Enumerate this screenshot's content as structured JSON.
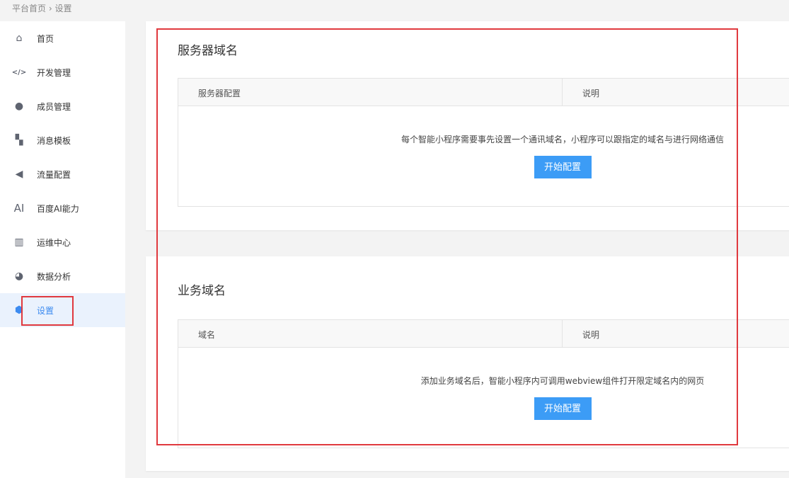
{
  "breadcrumb": {
    "home": "平台首页",
    "sep": "›",
    "current": "设置"
  },
  "sidebar": {
    "items": [
      {
        "label": "首页",
        "icon": "home-icon"
      },
      {
        "label": "开发管理",
        "icon": "code-icon"
      },
      {
        "label": "成员管理",
        "icon": "user-icon"
      },
      {
        "label": "消息模板",
        "icon": "template-icon"
      },
      {
        "label": "流量配置",
        "icon": "megaphone-icon"
      },
      {
        "label": "百度AI能力",
        "icon": "ai-icon"
      },
      {
        "label": "运维中心",
        "icon": "chart-icon"
      },
      {
        "label": "数据分析",
        "icon": "pie-icon"
      },
      {
        "label": "设置",
        "icon": "settings-icon",
        "active": true
      }
    ]
  },
  "server": {
    "title": "服务器域名",
    "col1": "服务器配置",
    "col2": "说明",
    "desc": "每个智能小程序需要事先设置一个通讯域名，小程序可以跟指定的域名与进行网络通信",
    "button": "开始配置"
  },
  "business": {
    "title": "业务域名",
    "col1": "域名",
    "col2": "说明",
    "desc": "添加业务域名后，智能小程序内可调用webview组件打开限定域名内的网页",
    "button": "开始配置"
  },
  "colors": {
    "accent": "#3c9cf6",
    "highlight": "#e0393e"
  }
}
